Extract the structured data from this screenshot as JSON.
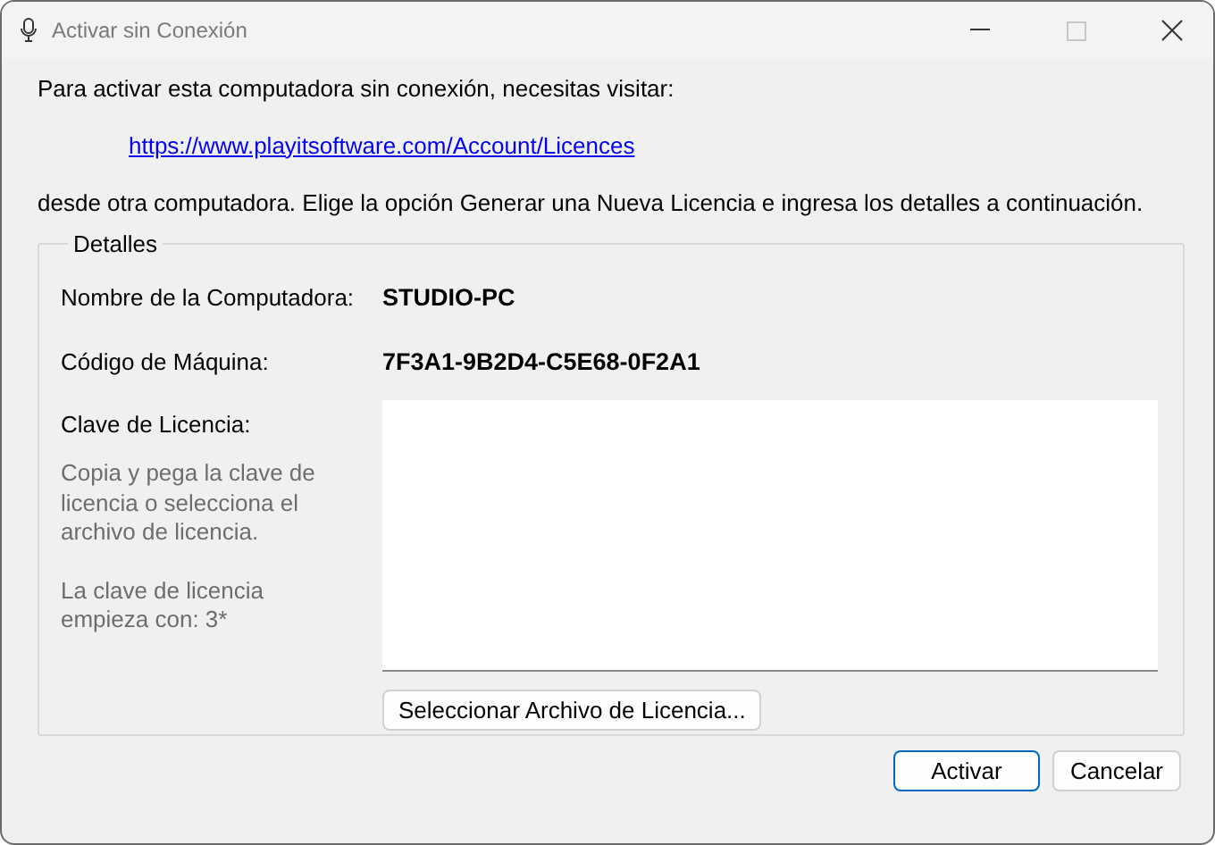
{
  "window": {
    "title": "Activar sin Conexión"
  },
  "intro": "Para activar esta computadora sin conexión, necesitas visitar:",
  "link": "https://www.playitsoftware.com/Account/Licences",
  "instructions": "desde otra computadora. Elige la opción Generar una Nueva Licencia e ingresa los detalles a continuación.",
  "details": {
    "legend": "Detalles",
    "fields": [
      {
        "label": "Nombre de la Computadora:",
        "value": "STUDIO-PC"
      },
      {
        "label": "Código de Máquina:",
        "value": "7F3A1-9B2D4-C5E68-0F2A1"
      }
    ],
    "license": {
      "label": "Clave de Licencia:",
      "hints": [
        "Copia y pega la clave de licencia o selecciona el archivo de licencia.",
        "La clave de licencia empieza con: 3*"
      ],
      "select_button": "Seleccionar Archivo de Licencia..."
    }
  },
  "buttons": [
    {
      "label": "Activar",
      "default": true
    },
    {
      "label": "Cancelar",
      "default": false
    }
  ]
}
